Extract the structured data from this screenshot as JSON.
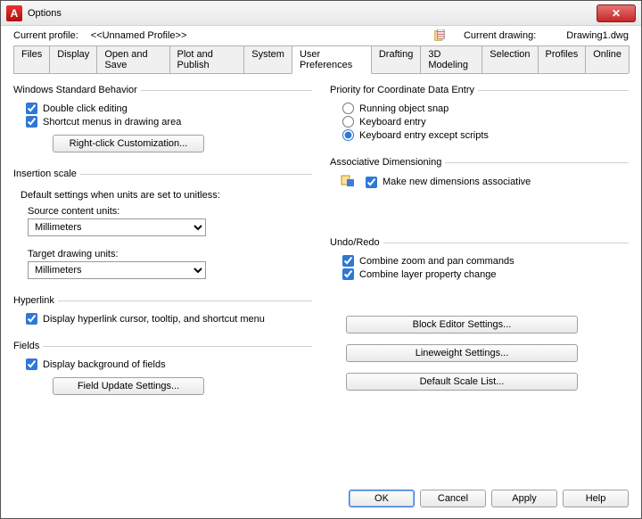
{
  "window": {
    "title": "Options"
  },
  "header": {
    "current_profile_label": "Current profile:",
    "current_profile_value": "<<Unnamed Profile>>",
    "current_drawing_label": "Current drawing:",
    "current_drawing_value": "Drawing1.dwg"
  },
  "tabs": [
    {
      "label": "Files",
      "active": false
    },
    {
      "label": "Display",
      "active": false
    },
    {
      "label": "Open and Save",
      "active": false
    },
    {
      "label": "Plot and Publish",
      "active": false
    },
    {
      "label": "System",
      "active": false
    },
    {
      "label": "User Preferences",
      "active": true
    },
    {
      "label": "Drafting",
      "active": false
    },
    {
      "label": "3D Modeling",
      "active": false
    },
    {
      "label": "Selection",
      "active": false
    },
    {
      "label": "Profiles",
      "active": false
    },
    {
      "label": "Online",
      "active": false
    }
  ],
  "left": {
    "wsb": {
      "legend": "Windows Standard Behavior",
      "dbl_click": {
        "label": "Double click editing",
        "checked": true
      },
      "shortcut_menus": {
        "label": "Shortcut menus in drawing area",
        "checked": true
      },
      "rc_button": "Right-click Customization..."
    },
    "insertion": {
      "legend": "Insertion scale",
      "note": "Default settings when units are set to unitless:",
      "source_label": "Source content units:",
      "source_value": "Millimeters",
      "target_label": "Target drawing units:",
      "target_value": "Millimeters"
    },
    "hyperlink": {
      "legend": "Hyperlink",
      "opt": {
        "label": "Display hyperlink cursor, tooltip, and shortcut menu",
        "checked": true
      }
    },
    "fields": {
      "legend": "Fields",
      "opt": {
        "label": "Display background of fields",
        "checked": true
      },
      "button": "Field Update Settings..."
    }
  },
  "right": {
    "priority": {
      "legend": "Priority for Coordinate Data Entry",
      "r1": {
        "label": "Running object snap",
        "selected": false
      },
      "r2": {
        "label": "Keyboard entry",
        "selected": false
      },
      "r3": {
        "label": "Keyboard entry except scripts",
        "selected": true
      }
    },
    "assoc": {
      "legend": "Associative Dimensioning",
      "opt": {
        "label": "Make new dimensions associative",
        "checked": true
      }
    },
    "undo": {
      "legend": "Undo/Redo",
      "opt1": {
        "label": "Combine zoom and pan commands",
        "checked": true
      },
      "opt2": {
        "label": "Combine layer property change",
        "checked": true
      }
    },
    "buttons": {
      "block": "Block Editor Settings...",
      "lw": "Lineweight Settings...",
      "scale": "Default Scale List..."
    }
  },
  "footer": {
    "ok": "OK",
    "cancel": "Cancel",
    "apply": "Apply",
    "help": "Help"
  }
}
